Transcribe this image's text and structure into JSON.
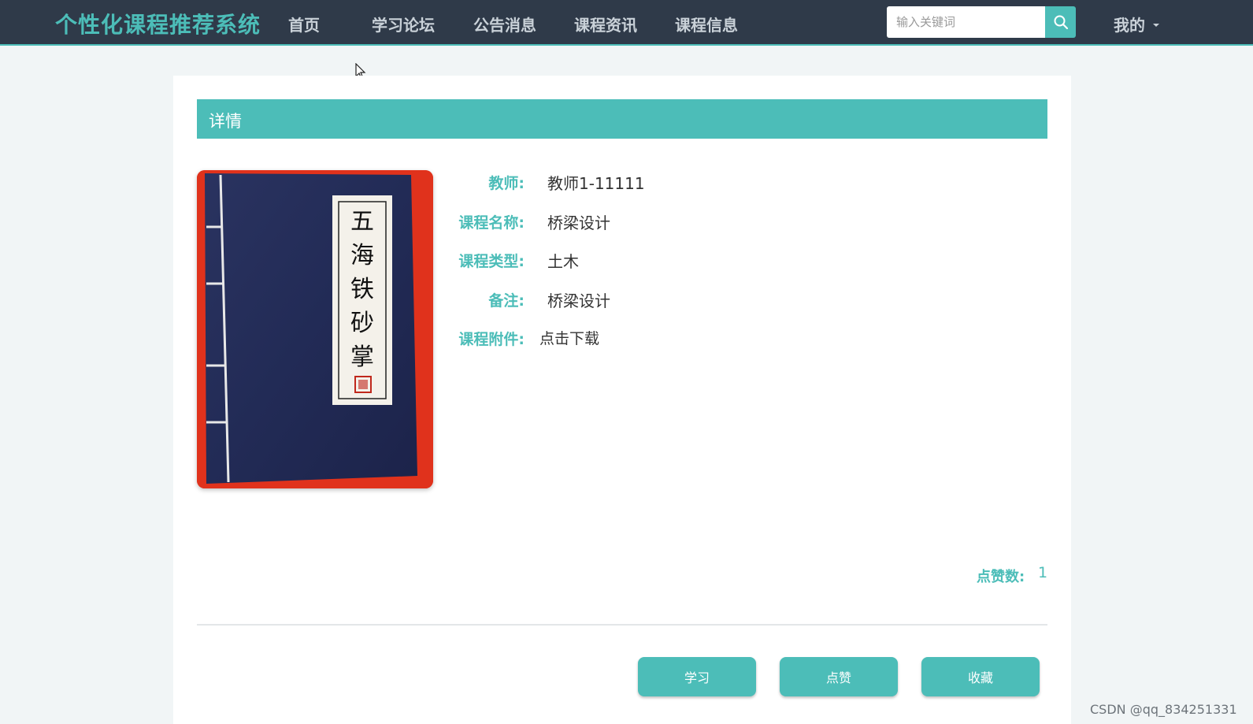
{
  "header": {
    "brand": "个性化课程推荐系统",
    "nav": [
      "首页",
      "学习论坛",
      "公告消息",
      "课程资讯",
      "课程信息"
    ],
    "search_placeholder": "输入关键词",
    "user_menu": "我的"
  },
  "detail": {
    "section_title": "详情",
    "cover_image": {
      "title_chars": [
        "五",
        "海",
        "铁",
        "砂",
        "掌"
      ]
    },
    "fields": [
      {
        "label": "教师:",
        "value": "教师1-11111"
      },
      {
        "label": "课程名称:",
        "value": "桥梁设计"
      },
      {
        "label": "课程类型:",
        "value": "土木"
      },
      {
        "label": "备注:",
        "value": "桥梁设计"
      },
      {
        "label": "课程附件:",
        "value": "点击下载"
      }
    ],
    "likes_label": "点赞数:",
    "likes_count": "1"
  },
  "actions": {
    "study": "学习",
    "like": "点赞",
    "favorite": "收藏"
  },
  "watermark": "CSDN @qq_834251331",
  "colors": {
    "accent": "#4cbdb8",
    "topbar": "#2f3a49"
  }
}
